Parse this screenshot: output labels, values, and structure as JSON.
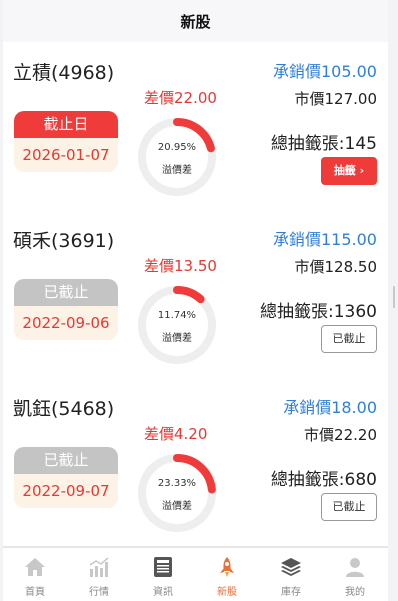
{
  "header": {
    "title": "新股"
  },
  "stocks": [
    {
      "name": "立積(4968)",
      "diff": "差價22.00",
      "status": "截止日",
      "date": "2026-01-07",
      "ring_pct": "20.95%",
      "ring_fraction": 0.2095,
      "ring_label": "溢價差",
      "underwrite": "承銷價105.00",
      "market": "市價127.00",
      "lottery": "總抽籤張:145",
      "button": "抽籤 ›"
    },
    {
      "name": "碩禾(3691)",
      "diff": "差價13.50",
      "status": "已截止",
      "date": "2022-09-06",
      "ring_pct": "11.74%",
      "ring_fraction": 0.1174,
      "ring_label": "溢價差",
      "underwrite": "承銷價115.00",
      "market": "市價128.50",
      "lottery": "總抽籤張:1360",
      "button": "已截止"
    },
    {
      "name": "凱鈺(5468)",
      "diff": "差價4.20",
      "status": "已截止",
      "date": "2022-09-07",
      "ring_pct": "23.33%",
      "ring_fraction": 0.2333,
      "ring_label": "溢價差",
      "underwrite": "承銷價18.00",
      "market": "市價22.20",
      "lottery": "總抽籤張:680",
      "button": "已截止"
    }
  ],
  "tabs": [
    {
      "label": "首頁",
      "icon": "home-icon"
    },
    {
      "label": "行情",
      "icon": "chart-icon"
    },
    {
      "label": "資訊",
      "icon": "news-icon"
    },
    {
      "label": "新股",
      "icon": "rocket-icon"
    },
    {
      "label": "庫存",
      "icon": "layers-icon"
    },
    {
      "label": "我的",
      "icon": "user-icon"
    }
  ],
  "colors": {
    "accent_red": "#f03b3b",
    "price_blue": "#2f7fd8",
    "active_tab": "#e8703a"
  }
}
